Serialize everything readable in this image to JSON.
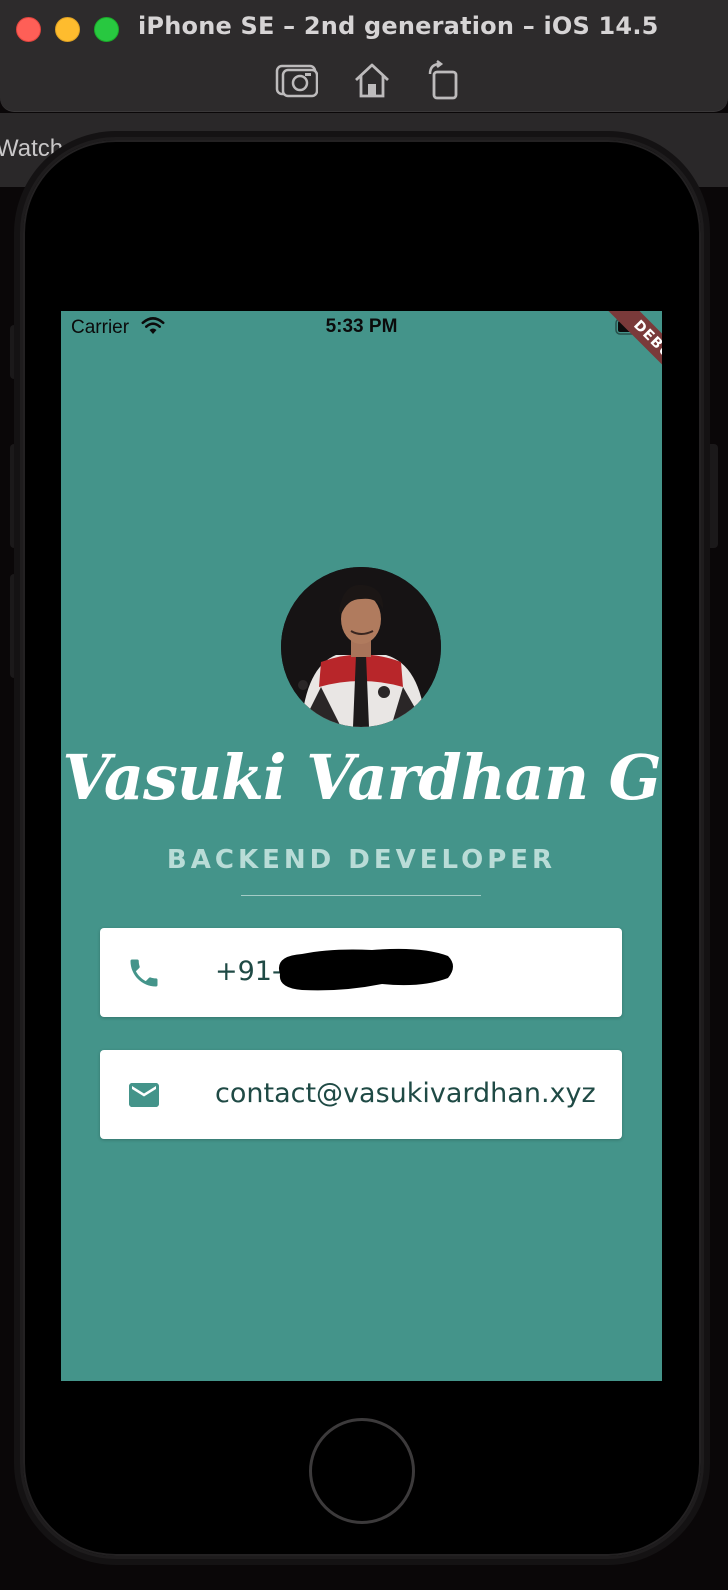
{
  "simulator": {
    "title": "iPhone SE – 2nd generation – iOS 14.5",
    "tab_label": "Watch",
    "toolbar": {
      "screenshot_icon": "camera-icon",
      "home_icon": "home-icon",
      "rotate_icon": "rotate-icon"
    }
  },
  "status_bar": {
    "carrier": "Carrier",
    "time": "5:33 PM",
    "wifi_icon": "wifi-icon",
    "battery_icon": "battery-icon"
  },
  "debug_banner": "DEBUG",
  "profile": {
    "name": "Vasuki Vardhan G",
    "role": "BACKEND DEVELOPER",
    "avatar": "profile-photo"
  },
  "contacts": {
    "phone": {
      "icon": "phone-icon",
      "text": "+91-"
    },
    "email": {
      "icon": "mail-icon",
      "text": "contact@vasukivardhan.xyz"
    }
  },
  "colors": {
    "background": "#44948a",
    "accent": "#44948a",
    "card": "#ffffff",
    "text_dark": "#1f4a45",
    "role_text": "#b9dcd7"
  }
}
